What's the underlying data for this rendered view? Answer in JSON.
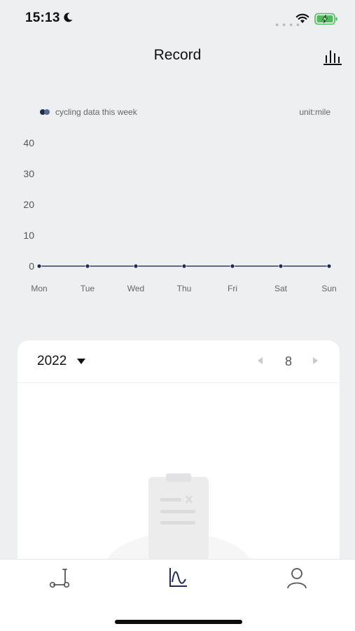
{
  "status_bar": {
    "time": "15:13"
  },
  "header": {
    "title": "Record"
  },
  "chart_legend": {
    "label": "cycling data this week",
    "unit": "unit:mile"
  },
  "chart_data": {
    "type": "line",
    "categories": [
      "Mon",
      "Tue",
      "Wed",
      "Thu",
      "Fri",
      "Sat",
      "Sun"
    ],
    "series": [
      {
        "name": "cycling data this week",
        "values": [
          0,
          0,
          0,
          0,
          0,
          0,
          0
        ]
      }
    ],
    "yticks": [
      0,
      10,
      20,
      30,
      40
    ],
    "ylim": [
      0,
      40
    ],
    "ylabel": "unit:mile",
    "colors": {
      "line": "#5a6a8e",
      "point": "#1f2a57"
    }
  },
  "calendar": {
    "year": "2022",
    "month": "8"
  },
  "tabs": [
    {
      "icon": "scooter-icon"
    },
    {
      "icon": "chart-line-icon",
      "active": true
    },
    {
      "icon": "user-icon"
    }
  ],
  "colors": {
    "accent": "#1f2a57",
    "background": "#eeeff1"
  }
}
